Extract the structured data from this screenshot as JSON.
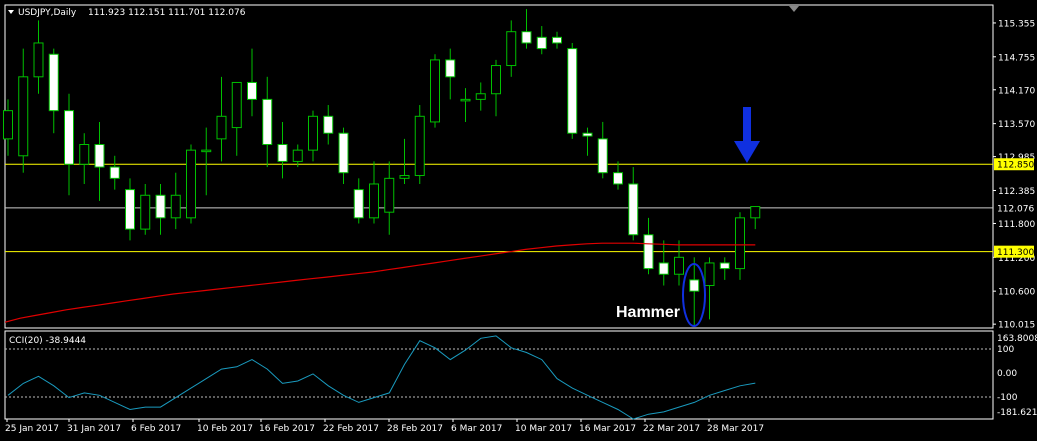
{
  "header": {
    "symbol": "USDJPY,Daily",
    "ohlc": "111.923 112.151 111.701 112.076"
  },
  "indicator": {
    "label": "CCI(20) -38.9444",
    "axis_labels": [
      "163.8008",
      "100",
      "0.00",
      "-100",
      "-181.6218"
    ]
  },
  "annotation": {
    "text": "Hammer"
  },
  "colors": {
    "background": "#000000",
    "bull": "#00c000",
    "bear_body": "#ffffff",
    "wick": "#00c000",
    "ma": "#e00000",
    "cci": "#1a9bbf",
    "hline": "#ffff00",
    "arrow": "#1030e0",
    "frame": "#ffffff"
  },
  "chart_data": {
    "type": "candlestick",
    "y_ticks": [
      "115.355",
      "114.755",
      "114.170",
      "113.570",
      "112.985",
      "112.385",
      "111.800",
      "111.200",
      "110.600",
      "110.015"
    ],
    "x_ticks": [
      "25 Jan 2017",
      "31 Jan 2017",
      "6 Feb 2017",
      "10 Feb 2017",
      "16 Feb 2017",
      "22 Feb 2017",
      "28 Feb 2017",
      "6 Mar 2017",
      "10 Mar 2017",
      "16 Mar 2017",
      "22 Mar 2017",
      "28 Mar 2017"
    ],
    "ylim": [
      110.0,
      115.62
    ],
    "levels": [
      {
        "value": 112.85,
        "label": "112.850",
        "boxed": true
      },
      {
        "value": 112.076,
        "label": "112.076",
        "boxed": false
      },
      {
        "value": 111.3,
        "label": "111.300",
        "boxed": true
      }
    ],
    "candles": [
      {
        "o": 113.3,
        "h": 114.0,
        "l": 113.0,
        "c": 113.8
      },
      {
        "o": 113.0,
        "h": 114.9,
        "l": 112.7,
        "c": 114.4
      },
      {
        "o": 114.4,
        "h": 115.4,
        "l": 114.1,
        "c": 115.0
      },
      {
        "o": 114.8,
        "h": 114.9,
        "l": 113.4,
        "c": 113.8
      },
      {
        "o": 113.8,
        "h": 114.1,
        "l": 112.3,
        "c": 112.85
      },
      {
        "o": 112.85,
        "h": 113.4,
        "l": 112.5,
        "c": 113.2
      },
      {
        "o": 113.2,
        "h": 113.6,
        "l": 112.2,
        "c": 112.8
      },
      {
        "o": 112.8,
        "h": 113.0,
        "l": 112.4,
        "c": 112.6
      },
      {
        "o": 112.4,
        "h": 112.6,
        "l": 111.5,
        "c": 111.7
      },
      {
        "o": 111.7,
        "h": 112.5,
        "l": 111.6,
        "c": 112.3
      },
      {
        "o": 112.3,
        "h": 112.5,
        "l": 111.6,
        "c": 111.9
      },
      {
        "o": 111.9,
        "h": 112.7,
        "l": 111.7,
        "c": 112.3
      },
      {
        "o": 111.9,
        "h": 113.2,
        "l": 111.8,
        "c": 113.1
      },
      {
        "o": 113.1,
        "h": 113.5,
        "l": 112.3,
        "c": 113.1
      },
      {
        "o": 113.3,
        "h": 114.4,
        "l": 112.9,
        "c": 113.7
      },
      {
        "o": 113.5,
        "h": 114.3,
        "l": 113.0,
        "c": 114.3
      },
      {
        "o": 114.3,
        "h": 114.9,
        "l": 113.7,
        "c": 114.0
      },
      {
        "o": 114.0,
        "h": 114.4,
        "l": 112.8,
        "c": 113.2
      },
      {
        "o": 113.2,
        "h": 113.6,
        "l": 112.6,
        "c": 112.9
      },
      {
        "o": 112.9,
        "h": 113.2,
        "l": 112.8,
        "c": 113.1
      },
      {
        "o": 113.1,
        "h": 113.8,
        "l": 112.9,
        "c": 113.7
      },
      {
        "o": 113.7,
        "h": 113.9,
        "l": 113.2,
        "c": 113.4
      },
      {
        "o": 113.4,
        "h": 113.5,
        "l": 112.5,
        "c": 112.7
      },
      {
        "o": 112.4,
        "h": 112.6,
        "l": 111.8,
        "c": 111.9
      },
      {
        "o": 111.9,
        "h": 112.9,
        "l": 111.8,
        "c": 112.5
      },
      {
        "o": 112.0,
        "h": 112.9,
        "l": 111.6,
        "c": 112.6
      },
      {
        "o": 112.6,
        "h": 113.3,
        "l": 112.5,
        "c": 112.65
      },
      {
        "o": 112.65,
        "h": 113.9,
        "l": 112.5,
        "c": 113.7
      },
      {
        "o": 113.6,
        "h": 114.8,
        "l": 113.5,
        "c": 114.7
      },
      {
        "o": 114.7,
        "h": 114.9,
        "l": 114.0,
        "c": 114.4
      },
      {
        "o": 114.0,
        "h": 114.2,
        "l": 113.6,
        "c": 114.0
      },
      {
        "o": 114.0,
        "h": 114.3,
        "l": 113.8,
        "c": 114.1
      },
      {
        "o": 114.1,
        "h": 114.7,
        "l": 113.7,
        "c": 114.6
      },
      {
        "o": 114.6,
        "h": 115.4,
        "l": 114.4,
        "c": 115.2
      },
      {
        "o": 115.2,
        "h": 115.6,
        "l": 114.9,
        "c": 115.0
      },
      {
        "o": 115.1,
        "h": 115.3,
        "l": 114.8,
        "c": 114.9
      },
      {
        "o": 115.1,
        "h": 115.2,
        "l": 114.9,
        "c": 115.0
      },
      {
        "o": 114.9,
        "h": 115.0,
        "l": 113.3,
        "c": 113.4
      },
      {
        "o": 113.4,
        "h": 113.5,
        "l": 113.0,
        "c": 113.35
      },
      {
        "o": 113.3,
        "h": 113.6,
        "l": 112.6,
        "c": 112.7
      },
      {
        "o": 112.7,
        "h": 112.9,
        "l": 112.4,
        "c": 112.5
      },
      {
        "o": 112.5,
        "h": 112.8,
        "l": 111.5,
        "c": 111.6
      },
      {
        "o": 111.6,
        "h": 111.9,
        "l": 110.9,
        "c": 111.0
      },
      {
        "o": 111.1,
        "h": 111.5,
        "l": 110.7,
        "c": 110.9
      },
      {
        "o": 110.9,
        "h": 111.5,
        "l": 110.7,
        "c": 111.2
      },
      {
        "o": 110.8,
        "h": 111.2,
        "l": 110.0,
        "c": 110.6
      },
      {
        "o": 110.7,
        "h": 111.2,
        "l": 110.1,
        "c": 111.1
      },
      {
        "o": 111.1,
        "h": 111.2,
        "l": 110.8,
        "c": 111.0
      },
      {
        "o": 111.0,
        "h": 112.0,
        "l": 110.8,
        "c": 111.9
      },
      {
        "o": 111.9,
        "h": 112.1,
        "l": 111.7,
        "c": 112.1
      }
    ],
    "ma": [
      110.05,
      110.12,
      110.17,
      110.22,
      110.27,
      110.31,
      110.35,
      110.39,
      110.43,
      110.47,
      110.51,
      110.55,
      110.58,
      110.61,
      110.64,
      110.67,
      110.7,
      110.73,
      110.76,
      110.79,
      110.82,
      110.85,
      110.88,
      110.91,
      110.94,
      110.98,
      111.02,
      111.06,
      111.1,
      111.14,
      111.18,
      111.22,
      111.26,
      111.3,
      111.34,
      111.37,
      111.4,
      111.42,
      111.44,
      111.45,
      111.45,
      111.45,
      111.44,
      111.43,
      111.42,
      111.42,
      111.42,
      111.42,
      111.42,
      111.42
    ],
    "cci": [
      -90,
      -40,
      -10,
      -50,
      -100,
      -80,
      -90,
      -120,
      -150,
      -140,
      -140,
      -100,
      -60,
      -20,
      20,
      30,
      60,
      20,
      -40,
      -30,
      0,
      -50,
      -90,
      -120,
      -100,
      -80,
      40,
      140,
      110,
      60,
      100,
      150,
      160,
      110,
      90,
      60,
      -20,
      -60,
      -90,
      -120,
      -150,
      -190,
      -170,
      -160,
      -140,
      -120,
      -90,
      -70,
      -50,
      -39
    ]
  }
}
